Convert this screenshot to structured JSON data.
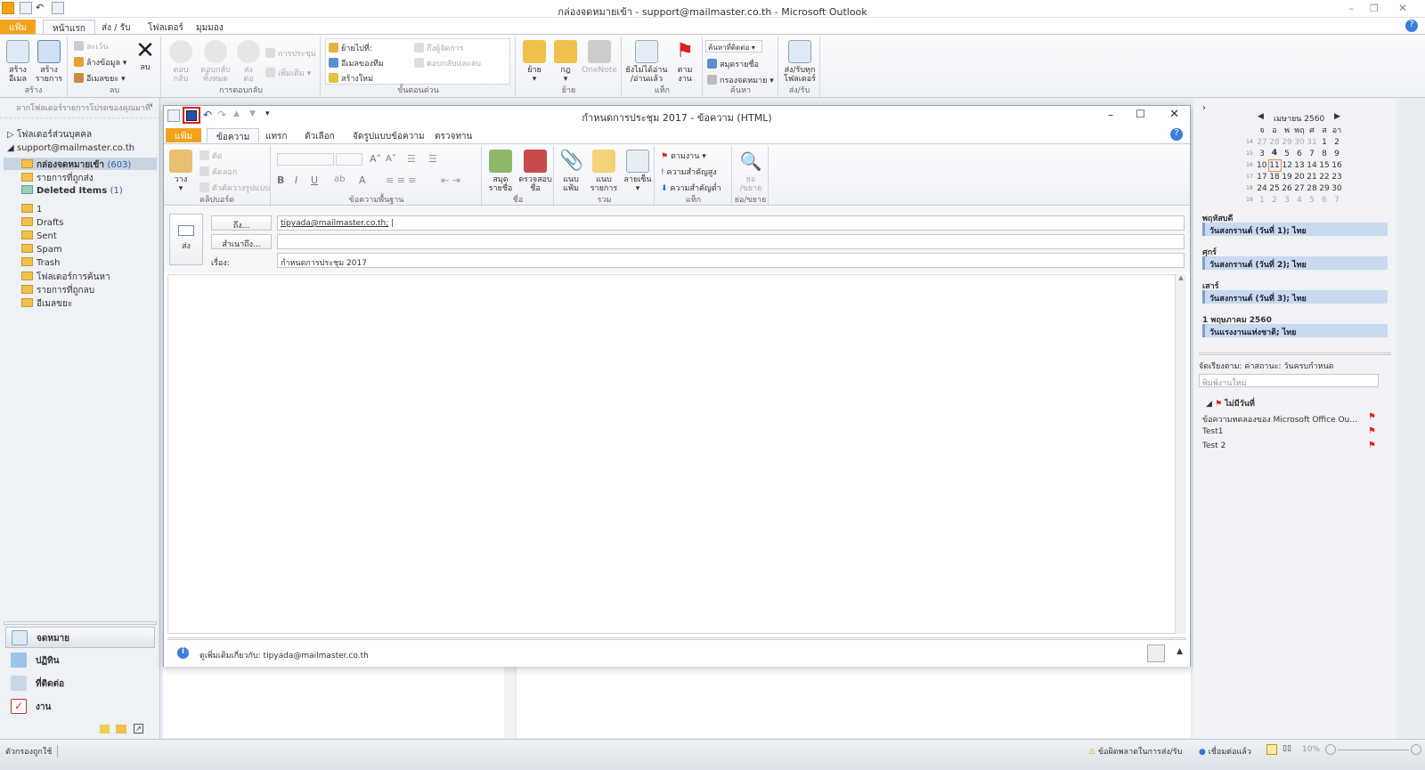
{
  "window": {
    "title": "กล่องจดหมายเข้า - support@mailmaster.co.th - Microsoft Outlook"
  },
  "main_tabs": [
    {
      "label": "แฟ้ม"
    },
    {
      "label": "หน้าแรก"
    },
    {
      "label": "ส่ง / รับ"
    },
    {
      "label": "โฟลเดอร์"
    },
    {
      "label": "มุมมอง"
    }
  ],
  "ribbon": {
    "groups": {
      "new": "สร้าง",
      "delete": "ลบ",
      "respond": "การตอบกลับ",
      "quicksteps": "ขั้นตอนด่วน",
      "move": "ย้าย",
      "tags": "แท็ก",
      "find": "ค้นหา",
      "sendreceive": "ส่ง/รับ"
    },
    "new_email": "สร้าง\nอีเมล",
    "new_items": "สร้าง\nรายการ",
    "ignore": "ละเว้น",
    "cleanup": "ล้างข้อมูล",
    "junk": "อีเมลขยะ",
    "delete": "ลบ",
    "reply": "ตอบ\nกลับ",
    "reply_all": "ตอบกลับ\nทั้งหมด",
    "forward": "ส่ง\nต่อ",
    "meeting": "การประชุม",
    "more": "เพิ่มเติม",
    "qs_moveto": "ย้ายไปที่:",
    "qs_team": "อีเมลของทีม",
    "qs_new": "สร้างใหม่",
    "qs_manager": "ถึงผู้จัดการ",
    "qs_replydelete": "ตอบกลับและลบ",
    "move": "ย้าย",
    "rules": "กฎ",
    "onenote": "OneNote",
    "unread": "ยังไม่ได้อ่าน\n/อ่านแล้ว",
    "followup": "ตาม\nงาน",
    "find_contact": "ค้นหาที่ติดต่อ",
    "address_book": "สมุดรายชื่อ",
    "filter_email": "กรองจดหมาย",
    "send_receive_all": "ส่ง/รับทุก\nโฟลเดอร์"
  },
  "nav": {
    "drag_hint": "ลากโฟลเดอร์รายการโปรดของคุณมาที่",
    "personal": "โฟลเดอร์ส่วนบุคคล",
    "account": "support@mailmaster.co.th",
    "folders": [
      {
        "label": "กล่องจดหมายเข้า",
        "count": "(603)",
        "bold": true,
        "selected": true
      },
      {
        "label": "รายการที่ถูกส่ง"
      },
      {
        "label": "Deleted Items",
        "count": "(1)",
        "bold": true
      },
      {
        "label": "1"
      },
      {
        "label": "Drafts"
      },
      {
        "label": "Sent"
      },
      {
        "label": "Spam"
      },
      {
        "label": "Trash"
      },
      {
        "label": "โฟลเดอร์การค้นหา"
      },
      {
        "label": "รายการที่ถูกลบ"
      },
      {
        "label": "อีเมลขยะ"
      }
    ],
    "modules": [
      {
        "label": "จดหมาย"
      },
      {
        "label": "ปฏิทิน"
      },
      {
        "label": "ที่ติดต่อ"
      },
      {
        "label": "งาน"
      }
    ]
  },
  "compose": {
    "title": "กำหนดการประชุม 2017 - ข้อความ (HTML)",
    "tabs": [
      {
        "label": "แฟ้ม"
      },
      {
        "label": "ข้อความ"
      },
      {
        "label": "แทรก"
      },
      {
        "label": "ตัวเลือก"
      },
      {
        "label": "จัดรูปแบบข้อความ"
      },
      {
        "label": "ตรวจทาน"
      }
    ],
    "ribbon": {
      "paste": "วาง",
      "cut": "ตัด",
      "copy": "คัดลอก",
      "format_painter": "ตัวคัดวางรูปแบบ",
      "clipboard": "คลิปบอร์ด",
      "basic_text": "ข้อความพื้นฐาน",
      "address_book": "สมุด\nรายชื่อ",
      "check_names": "ตรวจสอบ\nชื่อ",
      "names": "ชื่อ",
      "attach_file": "แนบ\nแฟ้ม",
      "attach_item": "แนบ\nรายการ",
      "signature": "ลายเซ็น",
      "include": "รวม",
      "followup": "ตามงาน",
      "high_importance": "ความสำคัญสูง",
      "low_importance": "ความสำคัญต่ำ",
      "tags": "แท็ก",
      "zoom": "ย่อ\n/ขยาย",
      "zoom_group": "ย่อ/ขยาย"
    },
    "send": "ส่ง",
    "to_btn": "ถึง...",
    "cc_btn": "สำเนาถึง...",
    "subject_label": "เรื่อง:",
    "to_value": "tipyada@mailmaster.co.th;",
    "cc_value": "",
    "subject_value": "กำหนดการประชุม 2017",
    "people_pane": "ดูเพิ่มเติมเกี่ยวกับ: tipyada@mailmaster.co.th"
  },
  "todo": {
    "month": "เมษายน 2560",
    "weekdays": [
      "จ",
      "อ",
      "พ",
      "พฤ",
      "ศ",
      "ส",
      "อา"
    ],
    "weeks": [
      {
        "wk": "14",
        "days": [
          "27",
          "28",
          "29",
          "30",
          "31",
          "1",
          "2"
        ]
      },
      {
        "wk": "15",
        "days": [
          "3",
          "4",
          "5",
          "6",
          "7",
          "8",
          "9"
        ]
      },
      {
        "wk": "16",
        "days": [
          "10",
          "11",
          "12",
          "13",
          "14",
          "15",
          "16"
        ]
      },
      {
        "wk": "17",
        "days": [
          "17",
          "18",
          "19",
          "20",
          "21",
          "22",
          "23"
        ]
      },
      {
        "wk": "18",
        "days": [
          "24",
          "25",
          "26",
          "27",
          "28",
          "29",
          "30"
        ]
      },
      {
        "wk": "19",
        "days": [
          "1",
          "2",
          "3",
          "4",
          "5",
          "6",
          "7"
        ]
      }
    ],
    "today": "11",
    "events": [
      {
        "day": "พฤหัสบดี",
        "title": "วันสงกรานต์ (วันที่ 1); ไทย"
      },
      {
        "day": "ศุกร์",
        "title": "วันสงกรานต์ (วันที่ 2); ไทย"
      },
      {
        "day": "เสาร์",
        "title": "วันสงกรานต์ (วันที่ 3); ไทย"
      },
      {
        "day": "1 พฤษภาคม 2560",
        "title": "วันแรงงานแห่งชาติ; ไทย"
      }
    ],
    "arrange": "จัดเรียงตาม: ค่าสถานะ: วันครบกำหนด",
    "new_task_placeholder": "พิมพ์งานใหม่",
    "group": "ไม่มีวันที่",
    "tasks": [
      "ข้อความทดลองของ Microsoft Office Ou...",
      "Test1",
      "Test 2"
    ]
  },
  "status": {
    "filter": "ตัวกรองถูกใช้",
    "error": "ข้อผิดพลาดในการส่ง/รับ",
    "connected": "เชื่อมต่อแล้ว",
    "zoom": "10%"
  },
  "colors": {
    "file_tab": "#f3a31a",
    "selected": "#c9d4e3",
    "event": "#c9d9ee",
    "highlight_save": "#e02020"
  }
}
